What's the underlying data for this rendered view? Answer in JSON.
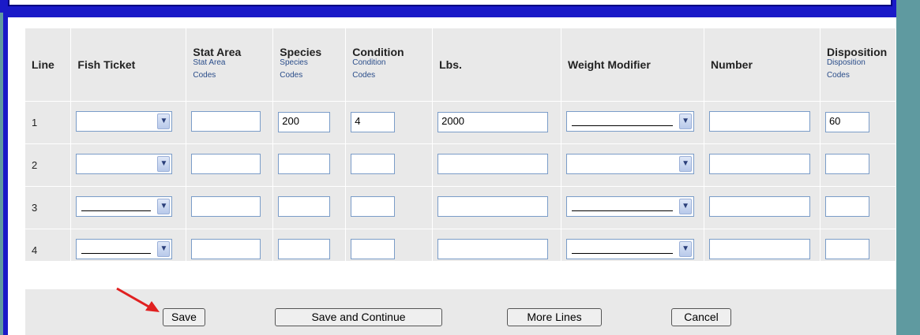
{
  "headers": [
    {
      "label": "Line",
      "sub": ""
    },
    {
      "label": "Fish Ticket",
      "sub": ""
    },
    {
      "label": "Stat Area",
      "sub": "Stat Area",
      "sub2": "Codes"
    },
    {
      "label": "Species",
      "sub": "Species",
      "sub2": "Codes"
    },
    {
      "label": "Condition",
      "sub": "Condition",
      "sub2": "Codes"
    },
    {
      "label": "Lbs.",
      "sub": ""
    },
    {
      "label": "Weight Modifier",
      "sub": ""
    },
    {
      "label": "Number",
      "sub": ""
    },
    {
      "label": "Disposition",
      "sub": "Disposition",
      "sub2": "Codes"
    }
  ],
  "rows": [
    {
      "line": "1",
      "fish_ticket": "",
      "stat_area": "",
      "species": "200",
      "condition": "4",
      "lbs": "2000",
      "weight_modifier": "",
      "number": "",
      "disposition": "60"
    },
    {
      "line": "2",
      "fish_ticket": "",
      "stat_area": "",
      "species": "",
      "condition": "",
      "lbs": "",
      "weight_modifier": "",
      "number": "",
      "disposition": ""
    },
    {
      "line": "3",
      "fish_ticket": "",
      "stat_area": "",
      "species": "",
      "condition": "",
      "lbs": "",
      "weight_modifier": "",
      "number": "",
      "disposition": ""
    },
    {
      "line": "4",
      "fish_ticket": "",
      "stat_area": "",
      "species": "",
      "condition": "",
      "lbs": "",
      "weight_modifier": "",
      "number": "",
      "disposition": ""
    }
  ],
  "buttons": {
    "save": "Save",
    "save_continue": "Save and Continue",
    "more_lines": "More Lines",
    "cancel": "Cancel"
  },
  "colors": {
    "frame": "#1a1ac8",
    "panel": "#e9e9e9",
    "annotation_arrow": "#e02020"
  }
}
